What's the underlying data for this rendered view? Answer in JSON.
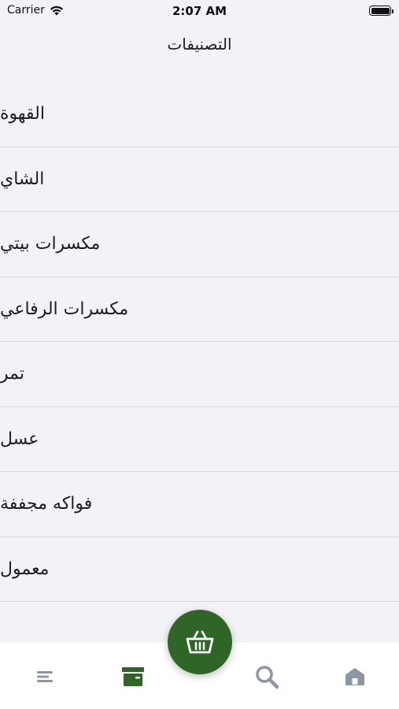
{
  "status_bar": {
    "carrier": "Carrier",
    "time": "2:07 AM"
  },
  "header": {
    "title": "التصنيفات"
  },
  "categories": [
    {
      "label": "القهوة"
    },
    {
      "label": "الشاي"
    },
    {
      "label": "مكسرات بيتي"
    },
    {
      "label": "مكسرات الرفاعي"
    },
    {
      "label": "تمر"
    },
    {
      "label": "عسل"
    },
    {
      "label": "فواكه مجففة"
    },
    {
      "label": "معمول"
    }
  ],
  "tab_bar": {
    "items": [
      {
        "icon": "menu-icon",
        "active": false
      },
      {
        "icon": "archive-icon",
        "active": true
      },
      {
        "icon": "search-icon",
        "active": false
      },
      {
        "icon": "home-icon",
        "active": false
      }
    ],
    "fab_icon": "basket-icon"
  },
  "colors": {
    "accent": "#2f6526",
    "inactive_icon": "#8e95a3",
    "background": "#f2f3f6",
    "divider": "#d7d9de"
  }
}
